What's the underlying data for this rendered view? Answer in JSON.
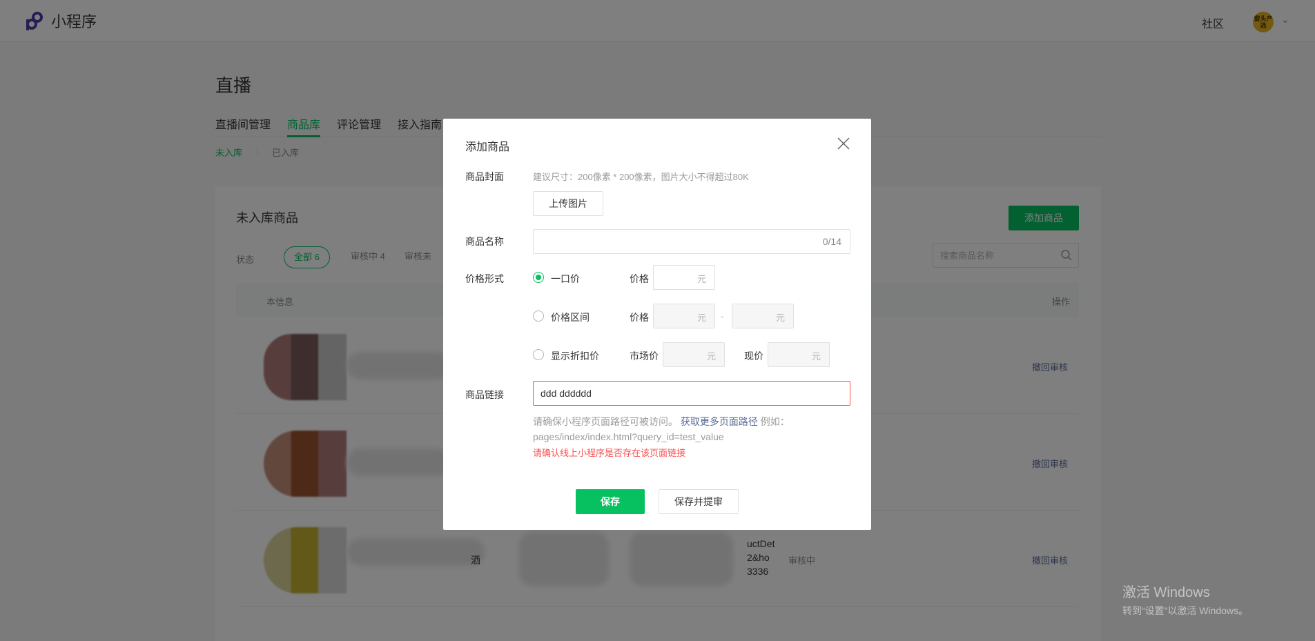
{
  "header": {
    "app_name": "小程序",
    "community": "社区",
    "avatar_text": "窗头产选",
    "avatar_color": "#e7b425"
  },
  "page": {
    "title": "直播",
    "tabs": [
      {
        "label": "直播间管理"
      },
      {
        "label": "商品库",
        "active": true
      },
      {
        "label": "评论管理"
      },
      {
        "label": "接入指南"
      }
    ],
    "subtabs": [
      {
        "label": "未入库",
        "active": true
      },
      {
        "label": "已入库"
      }
    ]
  },
  "card": {
    "title": "未入库商品",
    "add_button": "添加商品",
    "status_label": "状态",
    "status_filters": [
      {
        "label": "全部 6",
        "active": true
      },
      {
        "label": "审核中 4"
      },
      {
        "label": "审核未"
      }
    ],
    "search_placeholder": "搜索商品名称",
    "columns": {
      "info": "本信息",
      "action": "操作"
    },
    "rows": [
      {
        "action": "撤回审核"
      },
      {
        "action": "撤回审核"
      },
      {
        "name": "酒",
        "link_fragment_1": "uctDet",
        "link_fragment_2": "2&ho",
        "link_fragment_3": "3336",
        "status": "审核中",
        "action": "撤回审核"
      }
    ]
  },
  "dialog": {
    "title": "添加商品",
    "cover_label": "商品封面",
    "cover_hint": "建议尺寸：200像素 * 200像素，图片大小不得超过80K",
    "upload_button": "上传图片",
    "name_label": "商品名称",
    "name_value": "",
    "name_counter": "0/14",
    "price_label": "价格形式",
    "price_options": [
      {
        "label": "一口价",
        "checked": true,
        "field_label": "价格",
        "unit": "元"
      },
      {
        "label": "价格区间",
        "checked": false,
        "field_label": "价格",
        "unit": "元",
        "unit2": "元",
        "separator": "-"
      },
      {
        "label": "显示折扣价",
        "checked": false,
        "field_label": "市场价",
        "unit": "元",
        "field_label2": "现价",
        "unit2": "元"
      }
    ],
    "link_label": "商品链接",
    "link_value": "ddd dddddd",
    "link_help_prefix": "请确保小程序页面路径可被访问。",
    "link_help_link": "获取更多页面路径",
    "link_help_suffix": "例如：pages/index/index.html?query_id=test_value",
    "link_error": "请确认线上小程序是否存在该页面链接",
    "save_button": "保存",
    "save_submit_button": "保存并提审"
  },
  "watermark": {
    "title": "激活 Windows",
    "subtitle": "转到“设置”以激活 Windows。"
  },
  "colors": {
    "accent": "#07c160",
    "error": "#fa5151",
    "link": "#576b95"
  }
}
